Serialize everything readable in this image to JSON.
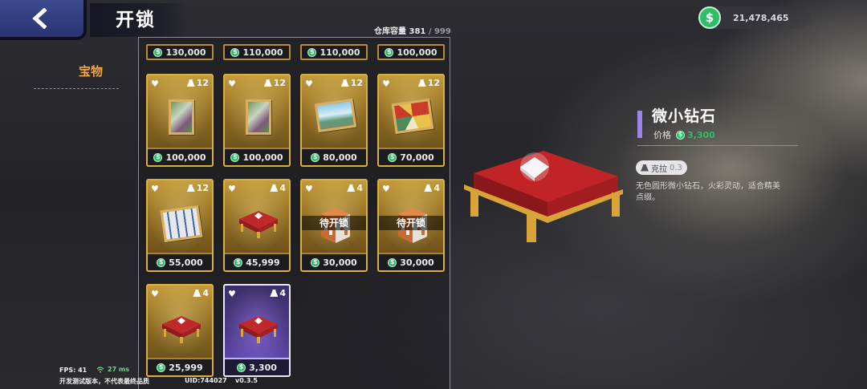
{
  "header": {
    "title": "开锁"
  },
  "sidebar": {
    "category": "宝物"
  },
  "capacity": {
    "label": "仓库容量",
    "used": "381",
    "max": "/ 999"
  },
  "currency": {
    "amount": "21,478,465",
    "symbol": "$"
  },
  "top_row_prices": [
    "130,000",
    "110,000",
    "110,000",
    "100,000"
  ],
  "cards": [
    {
      "weight": "12",
      "price": "100,000",
      "art": "painting-green"
    },
    {
      "weight": "12",
      "price": "100,000",
      "art": "painting-green"
    },
    {
      "weight": "12",
      "price": "80,000",
      "art": "painting-landscape"
    },
    {
      "weight": "12",
      "price": "70,000",
      "art": "painting-abstract"
    },
    {
      "weight": "12",
      "price": "55,000",
      "art": "painting-lines"
    },
    {
      "weight": "4",
      "price": "45,999",
      "art": "diamond-cushion"
    },
    {
      "weight": "4",
      "price": "30,000",
      "art": "gift-box",
      "locked_label": "待开锁"
    },
    {
      "weight": "4",
      "price": "30,000",
      "art": "gift-box",
      "locked_label": "待开锁"
    },
    {
      "weight": "4",
      "price": "25,999",
      "art": "diamond-cushion"
    },
    {
      "weight": "4",
      "price": "3,300",
      "art": "diamond-cushion",
      "selected": true
    }
  ],
  "detail": {
    "name": "微小钻石",
    "price_label": "价格",
    "price": "3,300",
    "weight_label": "克拉",
    "weight_value": "0.3",
    "description": "无色圆形微小钻石，火彩灵动，适合精美点缀。"
  },
  "debug": {
    "fps": "FPS: 41",
    "ping": "27 ms",
    "build_note": "开发测试版本，不代表最终品质",
    "uid": "UID:744027",
    "version": "v0.3.5"
  },
  "colors": {
    "coin": "#2fbd6a",
    "gold_border": "#d9b044",
    "accent_purple": "#9b85e8",
    "category": "#f0a548"
  }
}
